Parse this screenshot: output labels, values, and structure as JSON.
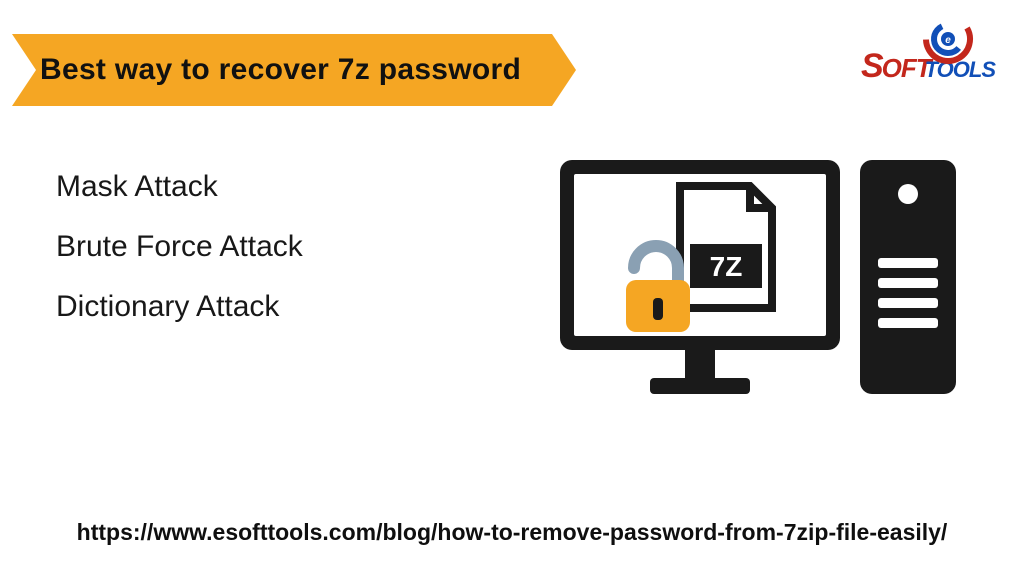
{
  "banner": {
    "title": "Best way to recover 7z password"
  },
  "logo": {
    "name": "eSoftTools",
    "part_s": "S",
    "part_oft": "OFT",
    "part_tools": "TOOLS"
  },
  "methods": [
    "Mask Attack",
    "Brute Force Attack",
    "Dictionary Attack"
  ],
  "illustration": {
    "file_label": "7Z"
  },
  "footer_url": "https://www.esofttools.com/blog/how-to-remove-password-from-7zip-file-easily/"
}
